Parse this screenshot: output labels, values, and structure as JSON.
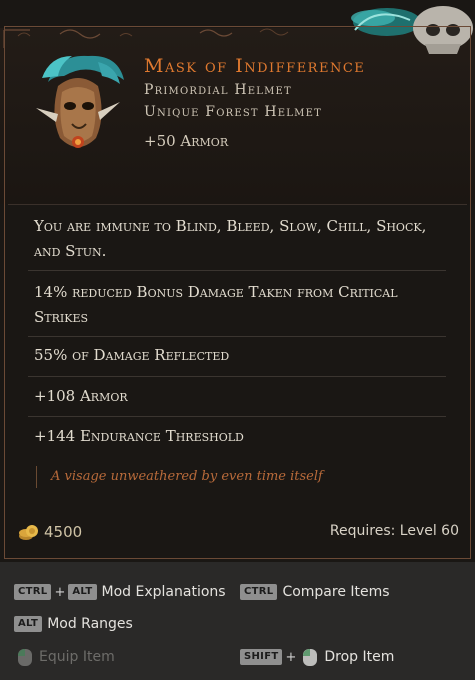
{
  "item": {
    "name": "Mask of Indifference",
    "base_type": "Primordial Helmet",
    "rarity_line": "Unique Forest Helmet",
    "implicit": "+50 Armor"
  },
  "mods": [
    "You are immune to Blind, Bleed, Slow, Chill, Shock, and Stun.",
    "14% reduced Bonus Damage Taken from Critical Strikes",
    "55% of Damage Reflected",
    "+108 Armor",
    "+144 Endurance Threshold"
  ],
  "flavor_text": "A visage unweathered by even time itself",
  "footer": {
    "price": "4500",
    "requires": "Requires: Level 60"
  },
  "hints": {
    "ctrl": "CTRL",
    "alt": "ALT",
    "shift": "SHIFT",
    "plus": "+",
    "mod_explanations": "Mod Explanations",
    "compare_items": "Compare Items",
    "mod_ranges": "Mod Ranges",
    "equip_item": "Equip Item",
    "drop_item": "Drop Item"
  },
  "colors": {
    "unique_name": "#e0792f",
    "flavor": "#b86a3a",
    "background": "#1a1714",
    "hint_bar": "#2a2928"
  }
}
